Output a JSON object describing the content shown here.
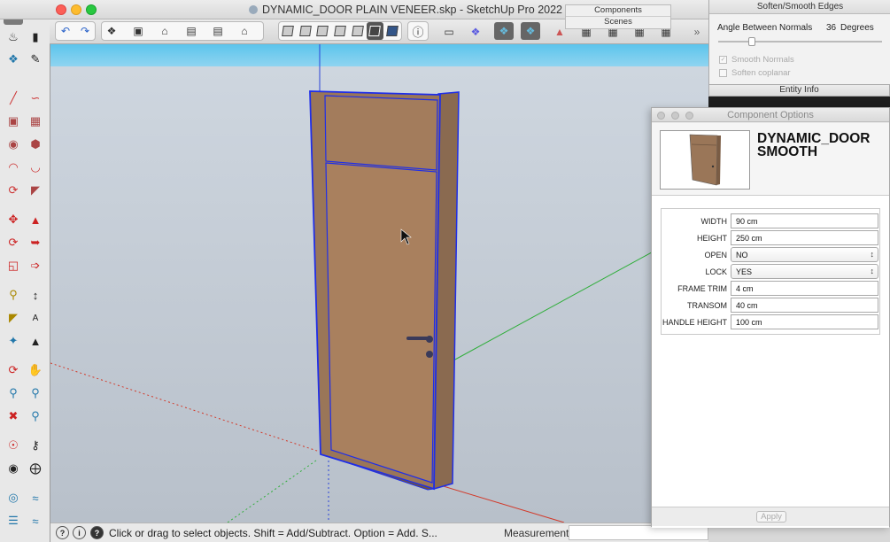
{
  "window": {
    "title": "DYNAMIC_DOOR PLAIN VENEER.skp - SketchUp Pro 2022"
  },
  "tray": {
    "components_label": "Components",
    "scenes_label": "Scenes"
  },
  "soften_panel": {
    "title": "Soften/Smooth Edges",
    "angle_label": "Angle Between Normals",
    "angle_value": "36",
    "angle_unit": "Degrees",
    "smooth_normals_label": "Smooth Normals",
    "soften_coplanar_label": "Soften coplanar"
  },
  "entity_info": {
    "title": "Entity Info"
  },
  "component_options": {
    "title": "Component Options",
    "name": "DYNAMIC_DOOR SMOOTH",
    "fields": [
      {
        "label": "WIDTH",
        "value": "90 cm",
        "type": "text"
      },
      {
        "label": "HEIGHT",
        "value": "250 cm",
        "type": "text"
      },
      {
        "label": "OPEN",
        "value": "NO",
        "type": "select"
      },
      {
        "label": "LOCK",
        "value": "YES",
        "type": "select"
      },
      {
        "label": "FRAME TRIM",
        "value": "4 cm",
        "type": "text"
      },
      {
        "label": "TRANSOM",
        "value": "40 cm",
        "type": "text"
      },
      {
        "label": "HANDLE HEIGHT",
        "value": "100 cm",
        "type": "text"
      }
    ],
    "apply_label": "Apply"
  },
  "status_bar": {
    "hint": "Click or drag to select objects. Shift = Add/Subtract. Option = Add. S...",
    "measurements_label": "Measurements"
  },
  "colors": {
    "selection": "#1f2ee8",
    "wood": "#a37c5c",
    "green_axis": "#2fae3a",
    "red_axis": "#d23a2a",
    "blue_axis": "#2a44d8"
  }
}
